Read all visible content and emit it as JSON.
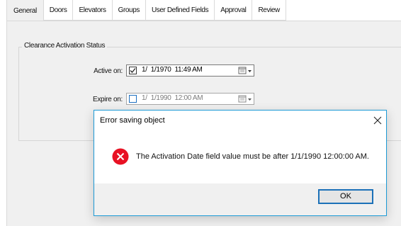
{
  "tabs": [
    {
      "label": "General",
      "active": true
    },
    {
      "label": "Doors"
    },
    {
      "label": "Elevators"
    },
    {
      "label": "Groups"
    },
    {
      "label": "User Defined Fields"
    },
    {
      "label": "Approval"
    },
    {
      "label": "Review"
    }
  ],
  "group": {
    "title": "Clearance Activation Status",
    "active_on": {
      "label": "Active on:",
      "checked": true,
      "value": "1/  1/1970  11:49 AM"
    },
    "expire_on": {
      "label": "Expire on:",
      "checked": false,
      "value": "1/  1/1990  12:00 AM"
    }
  },
  "dialog": {
    "title": "Error saving object",
    "message": "The Activation Date field value must be after 1/1/1990 12:00:00 AM.",
    "ok_label": "OK",
    "icon": "error-icon",
    "close_icon": "close-icon"
  },
  "colors": {
    "dialog_border": "#1c9ad6",
    "error_red": "#e81123",
    "ok_border": "#1c71b8"
  }
}
